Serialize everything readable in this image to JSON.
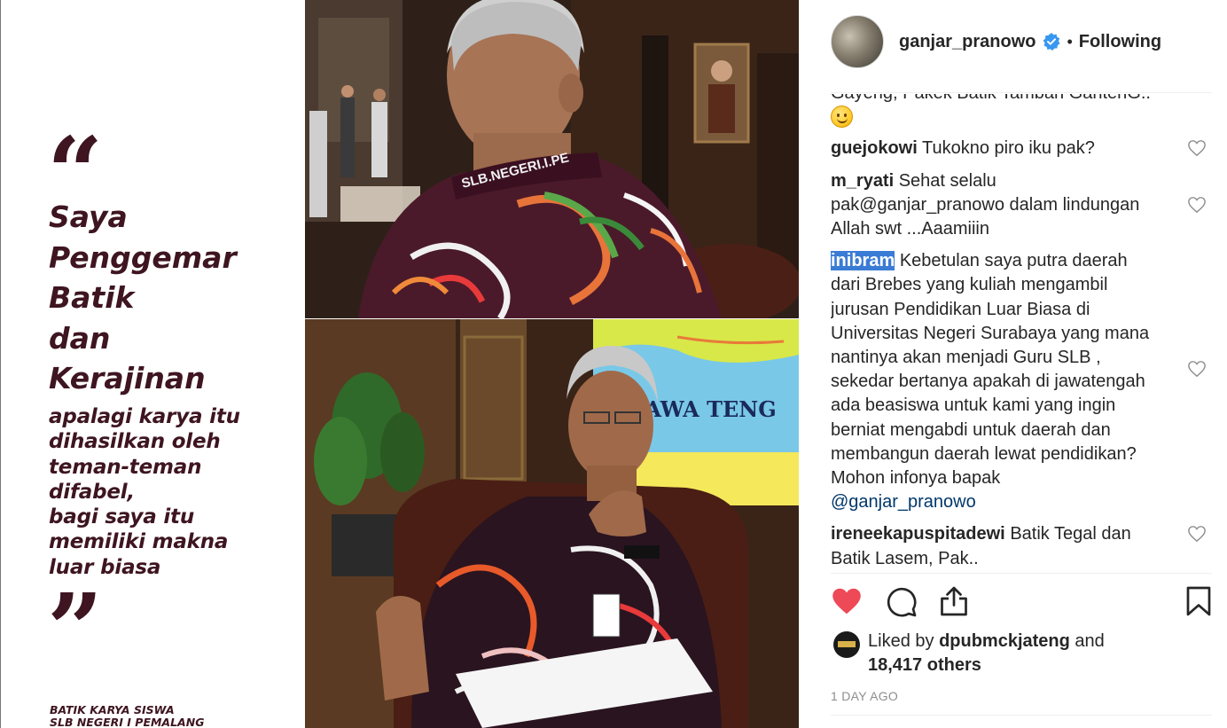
{
  "quote_panel": {
    "title": "Saya\nPenggemar\nBatik\ndan\nKerajinan",
    "body": "apalagi karya itu\ndihasilkan oleh\nteman-teman\ndifabel,\nbagi saya itu\nmemiliki makna\nluar biasa",
    "credit": "BATIK KARYA SISWA\nSLB NEGERI I PEMALANG",
    "open_quote": "“",
    "close_quote": "”",
    "color": "#3e1521"
  },
  "photos": {
    "top_shirt_text": "SLB.NEGERI.I.PE",
    "bottom_map_text": "A JAWA TENG"
  },
  "post": {
    "username": "ganjar_pranowo",
    "verified": true,
    "separator": "•",
    "follow_status": "Following",
    "comments": [
      {
        "author": "",
        "text": "Gayeng, Pakek Batik Tambah GantenG..",
        "emoji": true,
        "likeable": false
      },
      {
        "author": "guejokowi",
        "text": "Tukokno piro iku pak?",
        "likeable": true
      },
      {
        "author": "m_ryati",
        "text": "Sehat selalu pak@ganjar_pranowo dalam lindungan Allah swt ...Aaamiiin",
        "likeable": true
      },
      {
        "author": "inibram",
        "text": "Kebetulan saya putra daerah dari Brebes yang kuliah mengambil jurusan Pendidikan Luar Biasa di Universitas Negeri Surabaya yang mana nantinya akan menjadi Guru SLB , sekedar bertanya apakah di jawatengah ada beasiswa untuk kami yang ingin berniat mengabdi untuk daerah dan membangun daerah lewat pendidikan? Mohon infonya bapak",
        "mention": "@ganjar_pranowo",
        "highlight": true,
        "likeable": true
      },
      {
        "author": "ireneekapuspitadewi",
        "text": "Batik Tegal dan Batik Lasem, Pak..",
        "likeable": true
      }
    ],
    "likes": {
      "prefix": "Liked by",
      "user": "dpubmckjateng",
      "connector": "and",
      "others": "18,417 others"
    },
    "timestamp": "1 DAY AGO",
    "colors": {
      "like": "#ed4956",
      "verified": "#3897f0",
      "text": "#262626",
      "muted": "#8e8e8e"
    },
    "icons": [
      "heart-icon",
      "comment-icon",
      "share-icon",
      "bookmark-icon"
    ]
  }
}
